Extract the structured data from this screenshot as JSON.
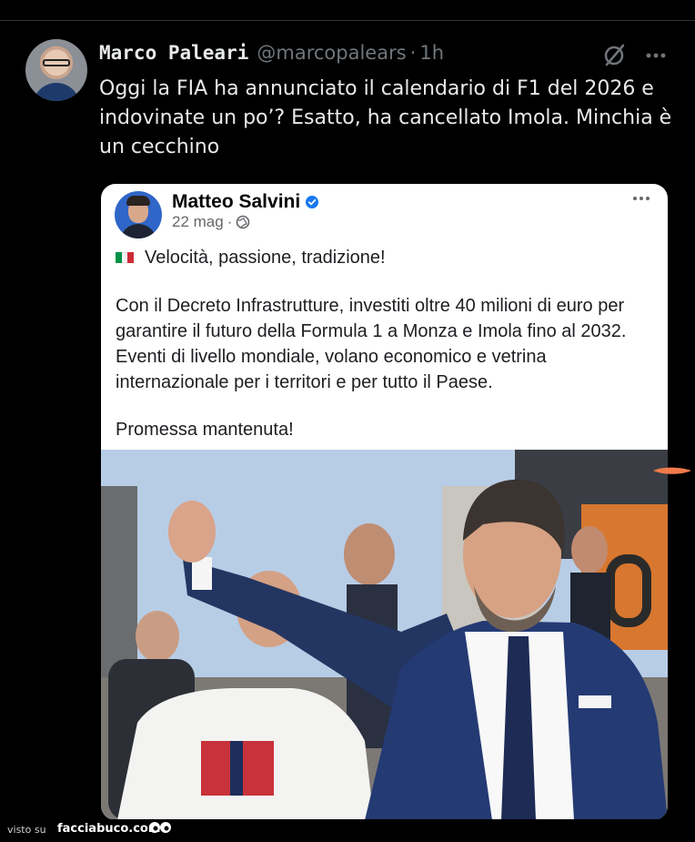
{
  "tweet": {
    "author_name": "Marco Paleari",
    "author_handle": "@marcopalears",
    "separator": "·",
    "time": "1h",
    "text": "Oggi la FIA ha annunciato il calendario di F1 del 2026 e indovinate un po’? Esatto, ha cancellato Imola. Minchia è un cecchino",
    "icons": {
      "grok": "grok-slash-icon",
      "more": "more-horizontal-icon"
    }
  },
  "embedded_post": {
    "author_name": "Matteo Salvini",
    "verified": true,
    "date": "22 mag",
    "separator": "·",
    "audience_icon": "globe-icon",
    "line1_flag": "italian-flag-icon",
    "line1": "Velocità, passione, tradizione!",
    "paragraph": "Con il Decreto Infrastrutture, investiti oltre 40 milioni di euro per garantire il futuro della Formula 1 a Monza e Imola fino al 2032. Eventi di livello mondiale, volano economico e vetrina internazionale per i territori e per tutto il Paese.",
    "closing": "Promessa mantenuta!"
  },
  "watermark": {
    "visto": "visto su",
    "site": "facciabuco.com"
  },
  "colors": {
    "background": "#000000",
    "text": "#e7e9ea",
    "secondary": "#71767b",
    "verified": "#1877f2",
    "flag_green": "#009246",
    "flag_white": "#ffffff",
    "flag_red": "#ce2b37",
    "mark": "#f07a4a"
  }
}
